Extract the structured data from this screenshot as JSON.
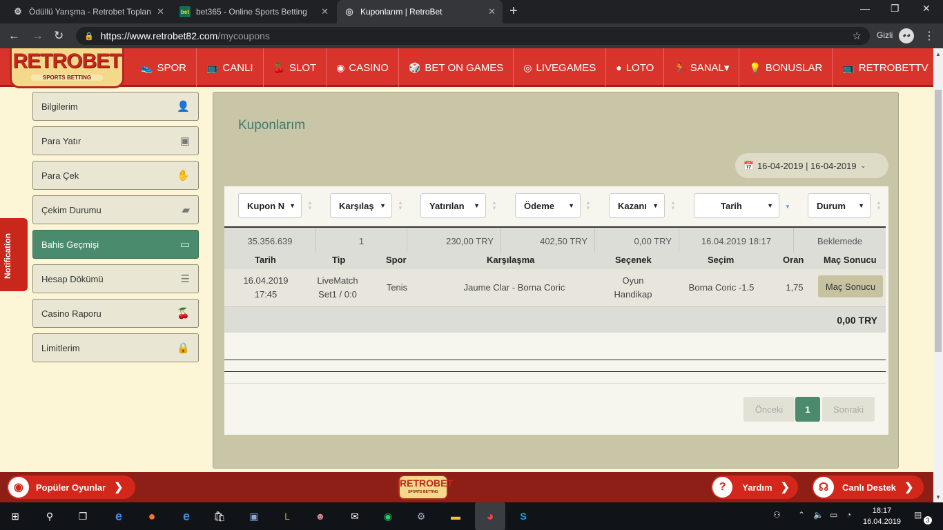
{
  "browser": {
    "tabs": [
      {
        "title": "Ödüllü Yarışma - Retrobet Toplan",
        "active": false
      },
      {
        "title": "bet365 - Online Sports Betting",
        "active": false
      },
      {
        "title": "Kuponlarım | RetroBet",
        "active": true
      }
    ],
    "url_host": "https://www.retrobet82.com",
    "url_path": "/mycoupons",
    "incognito_label": "Gizli"
  },
  "site": {
    "logo_text": "RETROBET",
    "logo_sub": "SPORTS BETTING",
    "nav": [
      {
        "label": "SPOR",
        "icon": "shoe-icon",
        "glyph": "👟"
      },
      {
        "label": "CANLI",
        "icon": "tv-icon",
        "glyph": "📺"
      },
      {
        "label": "SLOT",
        "icon": "cherries-icon",
        "glyph": "🍒"
      },
      {
        "label": "CASINO",
        "icon": "chip-icon",
        "glyph": "◉"
      },
      {
        "label": "BET ON GAMES",
        "icon": "dice-icon",
        "glyph": "🎲"
      },
      {
        "label": "LIVEGAMES",
        "icon": "target-icon",
        "glyph": "◎"
      },
      {
        "label": "LOTO",
        "icon": "balls-icon",
        "glyph": "●"
      },
      {
        "label": "SANAL▾",
        "icon": "runner-icon",
        "glyph": "🏃"
      },
      {
        "label": "BONUSLAR",
        "icon": "bulb-icon",
        "glyph": "💡"
      },
      {
        "label": "RETROBETTV",
        "icon": "tv2-icon",
        "glyph": "📺"
      }
    ]
  },
  "sidebar": {
    "items": [
      {
        "label": "Bilgilerim",
        "icon": "user-icon",
        "glyph": "👤"
      },
      {
        "label": "Para Yatır",
        "icon": "wallet-icon",
        "glyph": "▣"
      },
      {
        "label": "Para Çek",
        "icon": "hand-coin-icon",
        "glyph": "✋"
      },
      {
        "label": "Çekim Durumu",
        "icon": "money-icon",
        "glyph": "▰"
      },
      {
        "label": "Bahis Geçmişi",
        "icon": "ticket-icon",
        "glyph": "▭"
      },
      {
        "label": "Hesap Dökümü",
        "icon": "list-icon",
        "glyph": "☰"
      },
      {
        "label": "Casino Raporu",
        "icon": "cherry-icon",
        "glyph": "🍒"
      },
      {
        "label": "Limitlerim",
        "icon": "lock-icon",
        "glyph": "🔒"
      }
    ],
    "active_index": 4
  },
  "notification_label": "Notification",
  "main": {
    "title": "Kuponlarım",
    "date_range": "16-04-2019 | 16-04-2019",
    "filters": [
      "Kupon N",
      "Karşılaş",
      "Yatırılan",
      "Ödeme",
      "Kazanı",
      "Tarih",
      "Durum"
    ],
    "coupon": {
      "id": "35.356.639",
      "matches": "1",
      "stake": "230,00 TRY",
      "payout": "402,50 TRY",
      "won": "0,00 TRY",
      "date": "16.04.2019 18:17",
      "status": "Beklemede"
    },
    "detail_headers": [
      "Tarih",
      "Tip",
      "Spor",
      "Karşılaşma",
      "Seçenek",
      "Seçim",
      "Oran",
      "Maç Sonucu"
    ],
    "detail": {
      "date_line1": "16.04.2019",
      "date_line2": "17:45",
      "tip_line1": "LiveMatch",
      "tip_line2": "Set1 / 0:0",
      "sport": "Tenis",
      "match": "Jaume Clar - Borna Coric",
      "option_line1": "Oyun",
      "option_line2": "Handikap",
      "selection": "Borna Coric -1.5",
      "odds": "1,75",
      "result_button": "Maç Sonucu"
    },
    "total": "0,00 TRY",
    "pager": {
      "prev": "Önceki",
      "current": "1",
      "next": "Sonraki"
    }
  },
  "footer": {
    "popular": "Popüler Oyunlar",
    "help": "Yardım",
    "support": "Canlı Destek",
    "logo_text": "RETROBET",
    "logo_sub": "SPORTS BETTING"
  },
  "taskbar": {
    "time": "18:17",
    "date": "16.04.2019",
    "notif_count": "3"
  }
}
